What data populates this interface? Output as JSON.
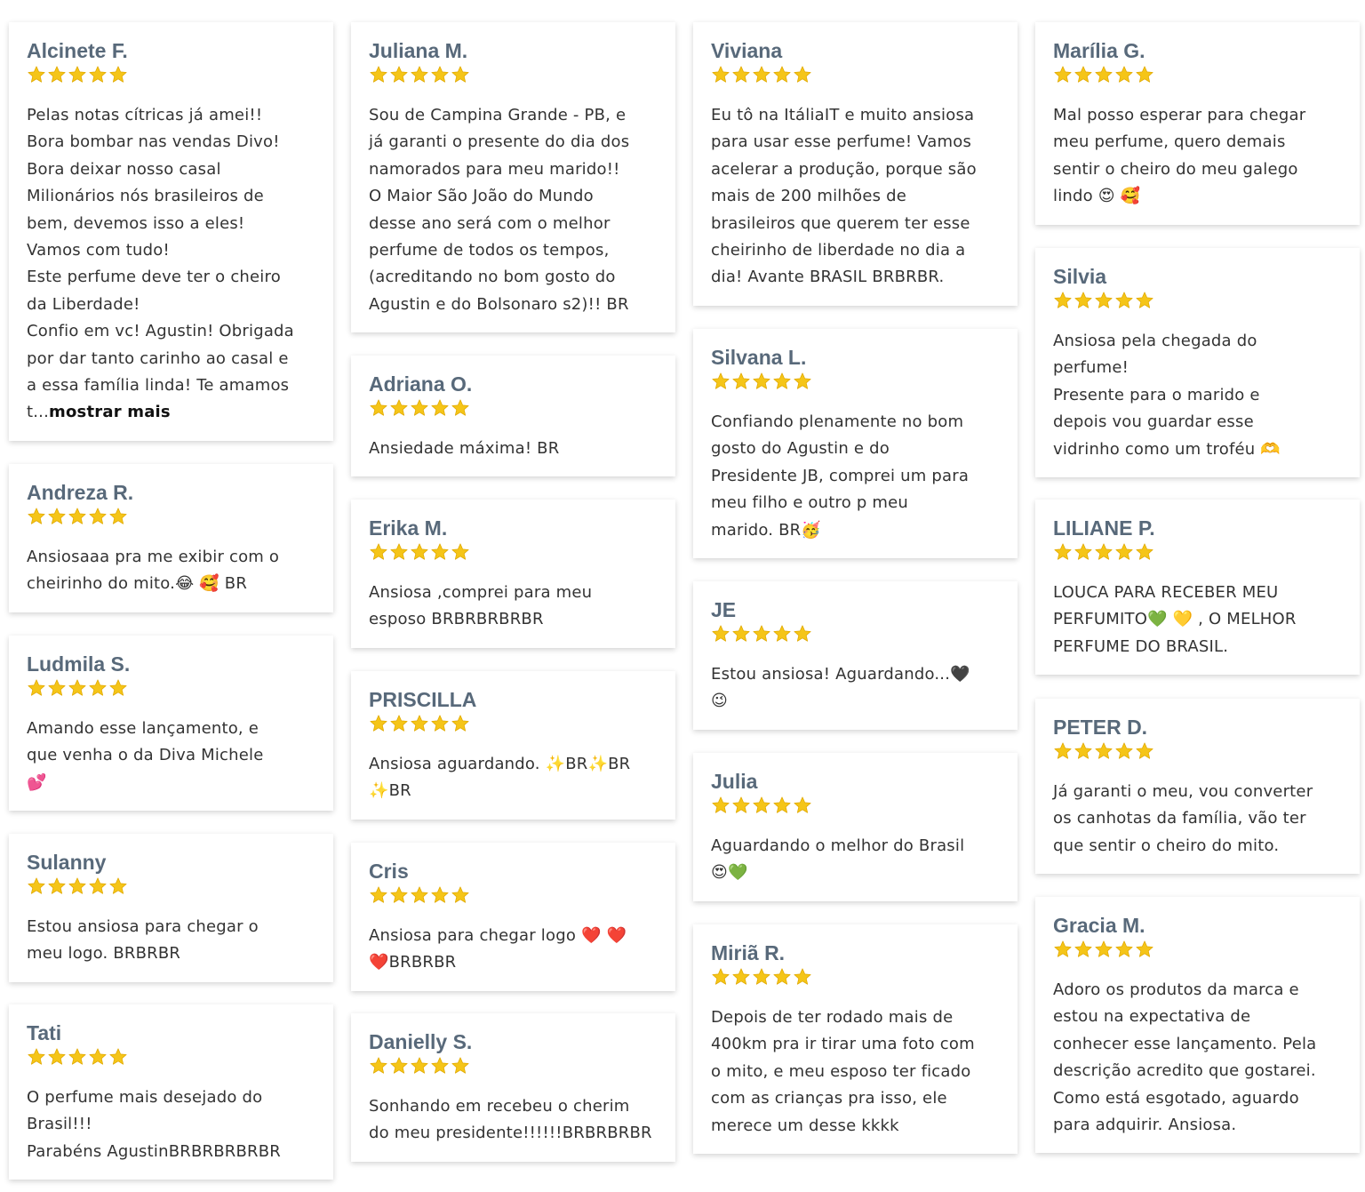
{
  "stars_color": "#f5c518",
  "columns": [
    [
      {
        "name": "Alcinete F.",
        "rating": 5,
        "text": "Pelas notas cítricas já amei!!\nBora bombar nas vendas Divo!\nBora deixar nosso casal\nMilionários nós brasileiros de\nbem, devemos isso a eles!\nVamos com tudo!\nEste perfume deve ter o cheiro\nda Liberdade!\nConfio em vc! Agustin! Obrigada\npor dar tanto carinho ao casal e\na essa família linda! Te amamos\nt...",
        "more": "mostrar mais"
      },
      {
        "name": "Andreza R.",
        "rating": 5,
        "text": "Ansiosaaa pra me exibir com o\ncheirinho do mito.😂 🥰 BR"
      },
      {
        "name": "Ludmila S.",
        "rating": 5,
        "text": "Amando esse lançamento, e\nque venha o    da Diva Michele\n💕"
      },
      {
        "name": "Sulanny",
        "rating": 5,
        "text": "Estou ansiosa para chegar o\nmeu logo. BRBRBR"
      },
      {
        "name": "Tati",
        "rating": 5,
        "text": "O perfume mais desejado do\nBrasil!!!\nParabéns AgustinBRBRBRBRBR"
      }
    ],
    [
      {
        "name": "Juliana M.",
        "rating": 5,
        "text": "Sou de Campina Grande - PB, e\njá garanti o presente do dia dos\nnamorados para meu marido!!\nO Maior São João do Mundo\ndesse ano será com o melhor\nperfume de todos os tempos,\n(acreditando no bom gosto do\nAgustin e do Bolsonaro s2)!! BR"
      },
      {
        "name": "Adriana O.",
        "rating": 5,
        "text": "Ansiedade máxima! BR"
      },
      {
        "name": "Erika M.",
        "rating": 5,
        "text": "Ansiosa ,comprei para meu\nesposo BRBRBRBRBR"
      },
      {
        "name": "PRISCILLA",
        "rating": 5,
        "text": "Ansiosa aguardando.  ✨BR✨BR\n✨BR"
      },
      {
        "name": "Cris",
        "rating": 5,
        "text": "Ansiosa para chegar logo  ❤️ ❤️\n❤️BRBRBR"
      },
      {
        "name": "Danielly S.",
        "rating": 5,
        "text": "Sonhando em recebeu o cherim\ndo meu presidente!!!!!!BRBRBRBR"
      }
    ],
    [
      {
        "name": "Viviana",
        "rating": 5,
        "text": "Eu tô na ItáliaIT e muito ansiosa\npara usar esse perfume!  Vamos\nacelerar a produção, porque são\nmais de 200 milhões de\nbrasileiros que querem ter esse\ncheirinho de liberdade no dia a\ndia! Avante BRASIL BRBRBR."
      },
      {
        "name": "Silvana L.",
        "rating": 5,
        "text": "Confiando plenamente no bom\ngosto do Agustin e do\nPresidente JB, comprei um para\nmeu filho e outro p meu\nmarido. BR🥳"
      },
      {
        "name": "JE",
        "rating": 5,
        "text": "Estou ansiosa! Aguardando...🖤\n😉"
      },
      {
        "name": "Julia",
        "rating": 5,
        "text": "Aguardando o melhor do Brasil\n😍💚"
      },
      {
        "name": "Miriã R.",
        "rating": 5,
        "text": "Depois de ter rodado mais de\n400km pra ir tirar uma foto com\no mito, e meu esposo ter ficado\ncom as crianças pra isso, ele\nmerece um desse kkkk"
      }
    ],
    [
      {
        "name": "Marília G.",
        "rating": 5,
        "text": "Mal posso esperar para chegar\nmeu perfume, quero demais\nsentir o cheiro do meu galego\nlindo 😍 🥰"
      },
      {
        "name": "Silvia",
        "rating": 5,
        "text": "Ansiosa pela chegada do\nperfume!\nPresente para o marido e\ndepois vou guardar esse\nvidrinho como um troféu 🫶"
      },
      {
        "name": "LILIANE P.",
        "rating": 5,
        "text": "LOUCA PARA RECEBER MEU\nPERFUMITO💚 💛 , O MELHOR\nPERFUME DO BRASIL."
      },
      {
        "name": "PETER D.",
        "rating": 5,
        "text": "Já garanti o meu, vou converter\nos canhotas da família, vão ter\nque sentir o cheiro do mito."
      },
      {
        "name": "Gracia M.",
        "rating": 5,
        "text": "Adoro os produtos da marca e\nestou na expectativa de\nconhecer esse lançamento. Pela\ndescrição acredito que gostarei.\nComo está esgotado, aguardo\npara adquirir. Ansiosa."
      }
    ]
  ]
}
